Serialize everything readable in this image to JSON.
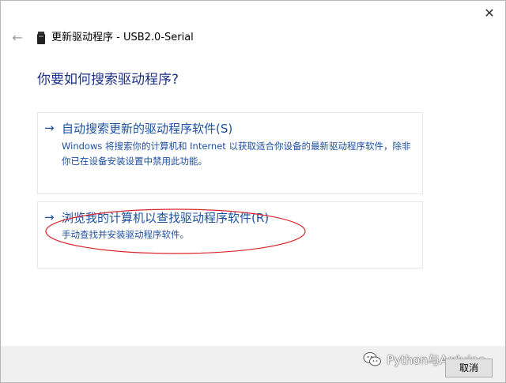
{
  "window": {
    "title": "更新驱动程序 - USB2.0-Serial",
    "close_icon": "close-icon",
    "back_icon": "back-arrow-icon",
    "device_icon": "usb-device-icon"
  },
  "main": {
    "heading": "你要如何搜索驱动程序?",
    "options": [
      {
        "arrow": "→",
        "title": "自动搜索更新的驱动程序软件(S)",
        "description": "Windows 将搜索你的计算机和 Internet 以获取适合你设备的最新驱动程序软件，除非你已在设备安装设置中禁用此功能。"
      },
      {
        "arrow": "→",
        "title": "浏览我的计算机以查找驱动程序软件(R)",
        "description": "手动查找并安装驱动程序软件。"
      }
    ]
  },
  "footer": {
    "cancel_label": "取消"
  },
  "watermark": {
    "text": "Python与Arduino",
    "icon": "wechat-icon"
  },
  "colors": {
    "heading": "#1e3287",
    "link": "#1e50a0",
    "annotation": "#d9262c",
    "footer_bg": "#f0f0f0"
  }
}
